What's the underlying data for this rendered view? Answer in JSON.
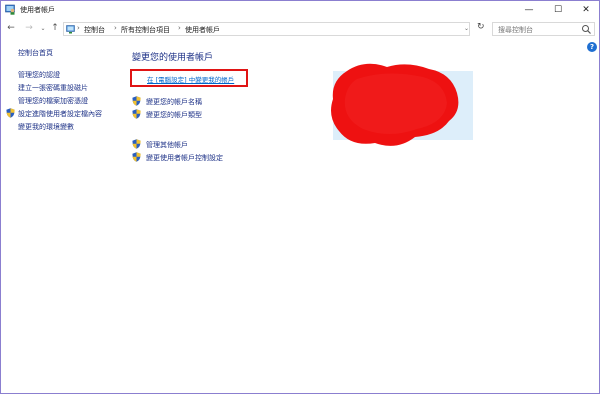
{
  "window": {
    "title": "使用者帳戶",
    "minimize_glyph": "—",
    "maximize_glyph": "☐",
    "close_glyph": "✕"
  },
  "navigation": {
    "back_glyph": "←",
    "forward_glyph": "→",
    "recent_glyph": "⌄",
    "up_glyph": "↑",
    "breadcrumbs": [
      "控制台",
      "所有控制台項目",
      "使用者帳戶"
    ],
    "separator": "›",
    "dropdown_glyph": "⌄",
    "refresh_glyph": "↻",
    "search_placeholder": "搜尋控制台"
  },
  "help": {
    "glyph": "?"
  },
  "sidebar": {
    "home": "控制台首頁",
    "items": [
      {
        "label": "管理您的認證",
        "icon": null
      },
      {
        "label": "建立一張密碼重設磁片",
        "icon": null
      },
      {
        "label": "管理您的檔案加密憑證",
        "icon": null
      },
      {
        "label": "設定進階使用者設定檔內容",
        "icon": "uac-shield-icon"
      },
      {
        "label": "變更我的環境變數",
        "icon": null
      }
    ]
  },
  "main": {
    "title": "變更您的使用者帳戶",
    "pc_settings_link": "在 [電腦設定] 中變更我的帳戶",
    "tasks": [
      {
        "label": "變更您的帳戶名稱",
        "icon": "uac-shield-icon"
      },
      {
        "label": "變更您的帳戶類型",
        "icon": "uac-shield-icon"
      }
    ],
    "other_tasks": [
      {
        "label": "管理其他帳戶",
        "icon": "uac-shield-icon"
      },
      {
        "label": "變更使用者帳戶控制設定",
        "icon": "uac-shield-icon"
      }
    ]
  },
  "colors": {
    "link": "#1e3287",
    "hyperlink": "#0066cc",
    "highlight_border": "#e01414",
    "avatar_panel": "#ddeefa",
    "redaction": "#ee1111",
    "window_border": "#8b7fd0"
  }
}
